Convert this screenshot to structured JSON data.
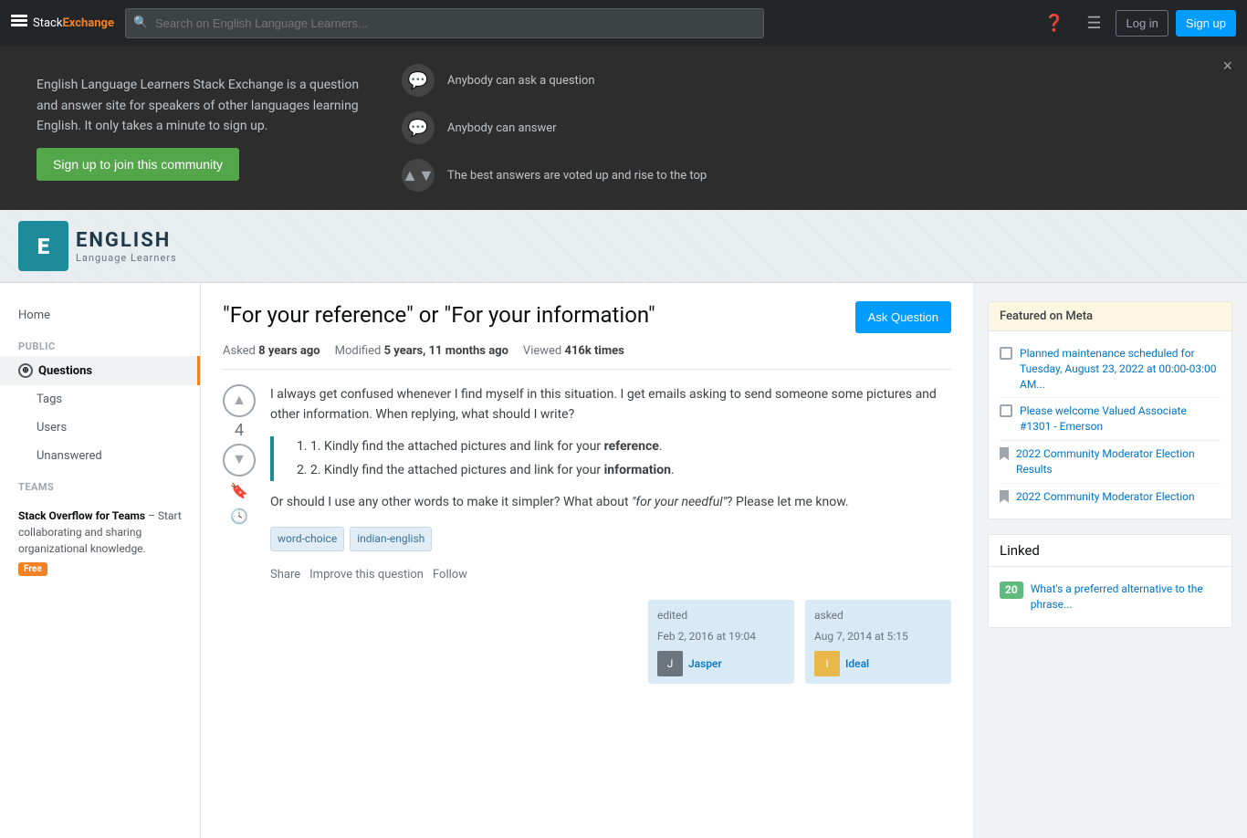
{
  "topnav": {
    "brand": "StackExchange",
    "brand_stack": "Stack",
    "brand_exchange": "Exchange",
    "search_placeholder": "Search on English Language Learners...",
    "login_label": "Log in",
    "signup_label": "Sign up"
  },
  "banner": {
    "description": "English Language Learners Stack Exchange is a question and answer site for speakers of other languages learning English. It only takes a minute to sign up.",
    "join_label": "Sign up to join this community",
    "close_label": "×",
    "features": [
      {
        "icon": "💬",
        "text": "Anybody can ask a question"
      },
      {
        "icon": "💬",
        "text": "Anybody can answer"
      },
      {
        "icon": "▲▼",
        "text": "The best answers are voted up and rise to the top"
      }
    ]
  },
  "site_header": {
    "logo_letter": "E",
    "logo_main": "ENGLISH",
    "logo_sub": "Language Learners"
  },
  "sidebar": {
    "public_label": "PUBLIC",
    "home_label": "Home",
    "questions_label": "Questions",
    "tags_label": "Tags",
    "users_label": "Users",
    "unanswered_label": "Unanswered",
    "teams_label": "TEAMS",
    "teams_description_1": "Stack Overflow for Teams",
    "teams_description_2": " – Start collaborating and sharing organizational knowledge.",
    "free_label": "Free"
  },
  "question": {
    "title": "\"For your reference\" or \"For your information\"",
    "ask_button": "Ask Question",
    "meta": {
      "asked_label": "Asked",
      "asked_value": "8 years ago",
      "modified_label": "Modified",
      "modified_value": "5 years, 11 months ago",
      "viewed_label": "Viewed",
      "viewed_value": "416k times"
    },
    "votes": 4,
    "body_1": "I always get confused whenever I find myself in this situation. I get emails asking to send someone some pictures and other information. When replying, what should I write?",
    "list_item_1_pre": "1. Kindly find the attached pictures and link for your ",
    "list_item_1_bold": "reference",
    "list_item_1_post": ".",
    "list_item_2_pre": "2. Kindly find the attached pictures and link for your ",
    "list_item_2_bold": "information",
    "list_item_2_post": ".",
    "body_2_pre": "Or should I use any other words to make it simpler? What about ",
    "body_2_italic": "\"for your needful\"",
    "body_2_post": "? Please let me know.",
    "tags": [
      "word-choice",
      "indian-english"
    ],
    "actions": {
      "share": "Share",
      "improve": "Improve this question",
      "follow": "Follow"
    },
    "edited": {
      "label": "edited",
      "date": "Feb 2, 2016 at 19:04",
      "user": "Jasper"
    },
    "asked_by": {
      "label": "asked",
      "date": "Aug 7, 2014 at 5:15",
      "user": "Ideal"
    }
  },
  "featured_meta": {
    "header": "Featured on Meta",
    "items": [
      {
        "type": "square",
        "text": "Planned maintenance scheduled for Tuesday, August 23, 2022 at 00:00-03:00 AM..."
      },
      {
        "type": "square",
        "text": "Please welcome Valued Associate #1301 - Emerson"
      },
      {
        "type": "bookmark",
        "text": "2022 Community Moderator Election Results"
      },
      {
        "type": "bookmark",
        "text": "2022 Community Moderator Election"
      }
    ]
  },
  "linked": {
    "header": "Linked",
    "items": [
      {
        "badge": "20",
        "badge_color": "green",
        "text": "What's a preferred alternative to the phrase..."
      }
    ]
  }
}
